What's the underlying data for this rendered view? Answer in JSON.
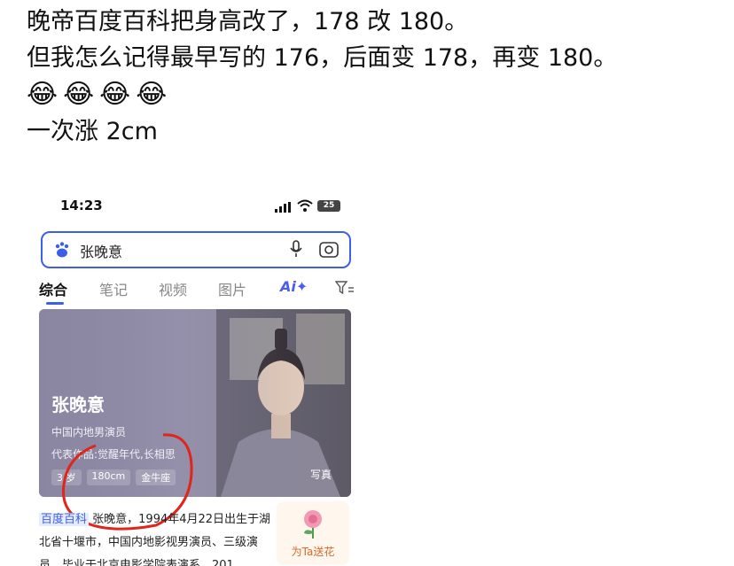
{
  "post": {
    "lines": [
      "晚帝百度百科把身高改了，178 改 180。",
      "但我怎么记得最早写的 176，后面变 178，再变 180。",
      "一次涨 2cm"
    ],
    "emojis": [
      "😂",
      "😂",
      "😂",
      "😂"
    ]
  },
  "phone": {
    "status": {
      "time": "14:23",
      "battery": "25"
    },
    "search": {
      "query": "张晚意"
    },
    "tabs": [
      "综合",
      "笔记",
      "视频",
      "图片",
      "Ai✦"
    ],
    "card": {
      "name": "张晚意",
      "desc": "中国内地男演员",
      "works": "代表作品:觉醒年代,长相思",
      "tags": [
        "3 岁",
        "180cm",
        "金牛座"
      ],
      "photo_label": "写真"
    },
    "info": {
      "source": "百度百科",
      "text": "张晚意，1994年4月22日出生于湖北省十堰市，中国内地影视男演员、三级演员，毕业于北京电影学院表演系。201..."
    },
    "gift": {
      "label": "为Ta送花"
    }
  },
  "colors": {
    "accent": "#3d5fe6",
    "annotation": "#e0251c"
  },
  "icons": [
    "signal-icon",
    "wifi-icon",
    "battery-icon",
    "baidu-paw-icon",
    "mic-icon",
    "camera-icon",
    "filter-icon",
    "flower-icon"
  ]
}
